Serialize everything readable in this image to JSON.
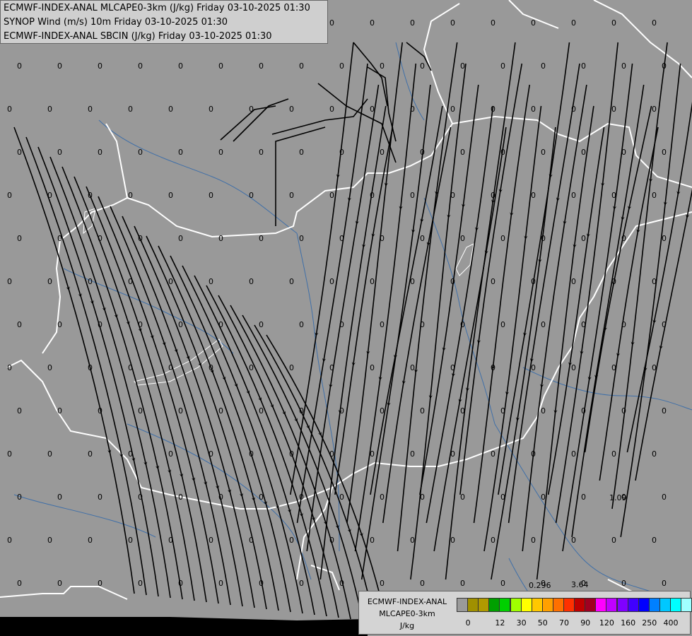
{
  "titles": [
    "ECMWF-INDEX-ANAL MLCAPE0-3km (J/kg) Friday 03-10-2025 01:30",
    "SYNOP Wind (m/s) 10m Friday 03-10-2025 01:30",
    "ECMWF-INDEX-ANAL SBCIN (J/kg) Friday 03-10-2025 01:30"
  ],
  "legend": {
    "model": "ECMWF-INDEX-ANAL",
    "parameter": "MLCAPE0-3km",
    "unit": "J/kg",
    "ticks": [
      "0",
      "12",
      "30",
      "50",
      "70",
      "90",
      "120",
      "160",
      "250",
      "400"
    ],
    "colors": [
      "#9a9a9a",
      "#a09000",
      "#b09a00",
      "#00a000",
      "#00d000",
      "#a0ff00",
      "#ffff00",
      "#ffc800",
      "#ffa000",
      "#ff7000",
      "#ff3000",
      "#c00000",
      "#a00020",
      "#ff00ff",
      "#c000ff",
      "#8000ff",
      "#4000ff",
      "#0000ff",
      "#0080ff",
      "#00c8ff",
      "#00ffff",
      "#a0ffff",
      "#ffffff"
    ]
  },
  "map": {
    "background": "#999999",
    "border_color": "#ffffff",
    "river_color": "#3f6fa8",
    "streamline_color": "#000000",
    "value_labels": [
      "0",
      "1.09",
      "0.296",
      "3.64"
    ]
  }
}
